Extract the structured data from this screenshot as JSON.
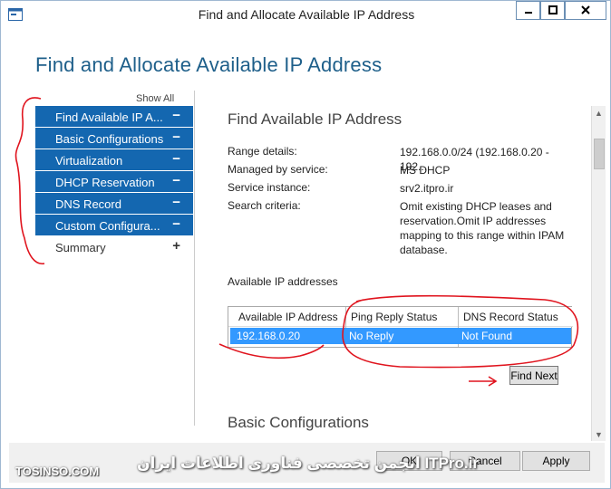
{
  "window": {
    "title": "Find and Allocate Available IP Address",
    "buttons": {
      "minimize": "minimize-icon",
      "maximize": "maximize-icon",
      "close": "close-icon"
    }
  },
  "dialog": {
    "heading": "Find and Allocate Available IP Address",
    "show_all": "Show All"
  },
  "nav": {
    "items": [
      {
        "label": "Find Available IP A...",
        "symbol": "−",
        "active": true
      },
      {
        "label": "Basic Configurations",
        "symbol": "−",
        "active": true
      },
      {
        "label": "Virtualization",
        "symbol": "−",
        "active": true
      },
      {
        "label": "DHCP Reservation",
        "symbol": "−",
        "active": true
      },
      {
        "label": "DNS Record",
        "symbol": "−",
        "active": true
      },
      {
        "label": "Custom Configura...",
        "symbol": "−",
        "active": true
      },
      {
        "label": "Summary",
        "symbol": "+",
        "active": false
      }
    ]
  },
  "main": {
    "section_title": "Find Available IP Address",
    "details": [
      {
        "key": "Range details:",
        "value": "192.168.0.0/24 (192.168.0.20 - 192..."
      },
      {
        "key": "Managed by service:",
        "value": "MS DHCP"
      },
      {
        "key": "Service instance:",
        "value": "srv2.itpro.ir"
      },
      {
        "key": "Search criteria:",
        "value": "Omit existing DHCP leases and reservation.Omit IP addresses mapping to this range within IPAM database."
      }
    ],
    "available_label": "Available IP addresses",
    "grid": {
      "columns": [
        "Available IP Address",
        "Ping Reply Status",
        "DNS Record Status"
      ],
      "rows": [
        [
          "192.168.0.20",
          "No Reply",
          "Not Found"
        ]
      ]
    },
    "find_next": "Find Next",
    "next_section": "Basic Configurations"
  },
  "footer": {
    "ok": "OK",
    "cancel": "Cancel",
    "apply": "Apply"
  },
  "watermark": {
    "left": "TOSINSO.COM",
    "middle": "انجمن تخصصی فناوری اطلاعات ایران ITPro.ir"
  },
  "colors": {
    "accent": "#1467b0",
    "selection": "#3399ff",
    "annotation": "#e0141e",
    "heading": "#1e5f8a"
  }
}
